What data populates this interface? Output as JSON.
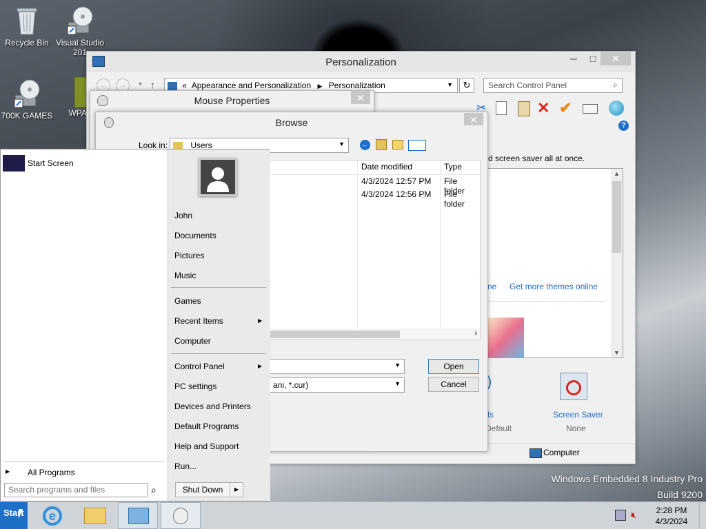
{
  "desktop": {
    "icons": [
      {
        "label": "Recycle Bin",
        "icon": "recycle-bin-icon"
      },
      {
        "label": "Visual Studio 201",
        "icon": "cd-drive-icon"
      },
      {
        "label": "700K GAMES",
        "icon": "cd-drive-icon"
      },
      {
        "label": "WPA_",
        "icon": "app-icon"
      }
    ],
    "watermark_line1": "Windows Embedded 8 Industry Pro",
    "watermark_line2": "Build 9200"
  },
  "personalization": {
    "title": "Personalization",
    "breadcrumb_sep": "«",
    "breadcrumb": [
      "Appearance and Personalization",
      "Personalization"
    ],
    "search_placeholder": "Search Control Panel",
    "description": "d screen saver all at once.",
    "theme_link_partial": "ne",
    "theme_link": "Get more themes online",
    "sounds_label_partial": "ls",
    "sounds_value_partial": "Default",
    "screen_saver_label": "Screen Saver",
    "screen_saver_value": "None",
    "status_computer": "Computer"
  },
  "mouse_properties": {
    "title": "Mouse Properties"
  },
  "browse": {
    "title": "Browse",
    "look_in_label": "Look in:",
    "look_in_value": "Users",
    "columns": [
      "Date modified",
      "Type"
    ],
    "rows": [
      {
        "date": "4/3/2024 12:57 PM",
        "type": "File folder"
      },
      {
        "date": "4/3/2024 12:56 PM",
        "type": "File folder"
      }
    ],
    "filter_partial": "ani, *.cur)",
    "open_label": "Open",
    "cancel_label": "Cancel"
  },
  "start_menu": {
    "pinned": "Start Screen",
    "user": "John",
    "items_group1": [
      "Documents",
      "Pictures",
      "Music"
    ],
    "items_group2": [
      "Games",
      "Recent Items",
      "Computer"
    ],
    "items_group3": [
      "Control Panel",
      "PC settings",
      "Devices and Printers",
      "Default Programs",
      "Help and Support",
      "Run..."
    ],
    "all_programs": "All Programs",
    "search_placeholder": "Search programs and files",
    "shutdown": "Shut Down"
  },
  "taskbar": {
    "start_label": "Start",
    "time": "2:28 PM",
    "date": "4/3/2024",
    "colors": {
      "taskbar": "#cfd4d8",
      "accent": "#1e6fc8"
    }
  }
}
